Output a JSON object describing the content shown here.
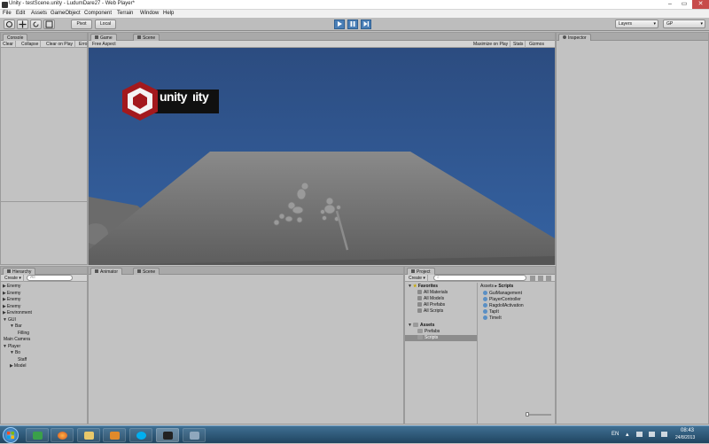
{
  "window": {
    "title": "Unity - testScene.unity - LudumDare27 - Web Player*",
    "minimize": "–",
    "maximize": "▭",
    "close": "✕"
  },
  "menu": [
    "File",
    "Edit",
    "Assets",
    "GameObject",
    "Component",
    "Terrain",
    "Window",
    "Help"
  ],
  "toolbar": {
    "pivot": "Pivot",
    "local": "Local",
    "layers": "Layers",
    "layout": "GP"
  },
  "console": {
    "tab": "Console",
    "buttons": [
      "Clear",
      "Collapse",
      "Clear on Play",
      "Erro"
    ]
  },
  "game": {
    "tabs": [
      "Game",
      "Scene"
    ],
    "aspect": "Free Aspect",
    "right_buttons": [
      "Maximize on Play",
      "Stats",
      "Gizmos"
    ],
    "logo_text": "unity",
    "logo_trail": "ıity"
  },
  "inspector": {
    "tab": "Inspector"
  },
  "hierarchy": {
    "tab": "Hierarchy",
    "create": "Create",
    "search": "All",
    "items": [
      {
        "label": "Enemy",
        "indent": 0,
        "arrow": "▶"
      },
      {
        "label": "Enemy",
        "indent": 0,
        "arrow": "▶"
      },
      {
        "label": "Enemy",
        "indent": 0,
        "arrow": "▶"
      },
      {
        "label": "Enemy",
        "indent": 0,
        "arrow": "▶"
      },
      {
        "label": "Environment",
        "indent": 0,
        "arrow": "▶"
      },
      {
        "label": "GUI",
        "indent": 0,
        "arrow": "▼"
      },
      {
        "label": "Bar",
        "indent": 1,
        "arrow": "▼"
      },
      {
        "label": "Filling",
        "indent": 2,
        "arrow": ""
      },
      {
        "label": "Main Camera",
        "indent": 0,
        "arrow": ""
      },
      {
        "label": "Player",
        "indent": 0,
        "arrow": "▼"
      },
      {
        "label": "Bo",
        "indent": 1,
        "arrow": "▼"
      },
      {
        "label": "Staff",
        "indent": 2,
        "arrow": ""
      },
      {
        "label": "Model",
        "indent": 1,
        "arrow": "▶"
      }
    ]
  },
  "animator": {
    "tabs": [
      "Animator",
      "Scene"
    ]
  },
  "project": {
    "tab": "Project",
    "create": "Create",
    "favorites_label": "Favorites",
    "favorites": [
      "All Materials",
      "All Models",
      "All Prefabs",
      "All Scripts"
    ],
    "assets_label": "Assets",
    "folders": [
      "Prefabs",
      "Scripts"
    ],
    "breadcrumb_root": "Assets",
    "breadcrumb_sep": "▸",
    "breadcrumb_current": "Scripts",
    "scripts": [
      "GuiManagement",
      "PlayerController",
      "RagdollActivation",
      "TapIt",
      "TimeIt"
    ]
  },
  "taskbar": {
    "lang": "EN",
    "time": "08:43",
    "date": "24/8/2013",
    "apps": [
      "start",
      "explorer",
      "firefox",
      "folder",
      "media",
      "skype",
      "unity",
      "misc"
    ]
  },
  "colors": {
    "sky": "#2e4f85",
    "floor": "#6e6e6e",
    "play_active": "#4a7fb7",
    "logo_red": "#a3191d"
  }
}
